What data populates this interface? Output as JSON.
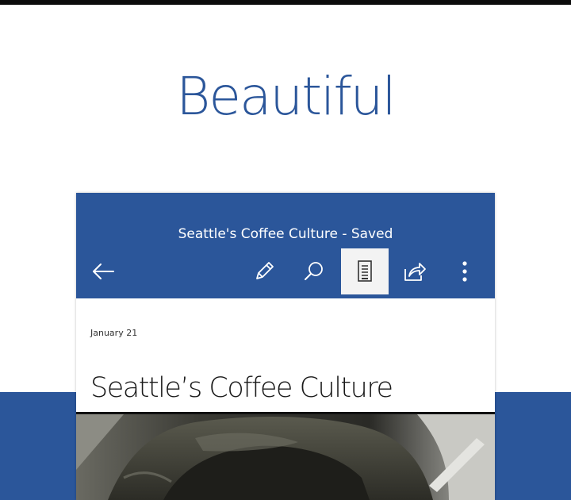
{
  "promo": {
    "headline": "Beautiful"
  },
  "app": {
    "doc_title": "Seattle's Coffee Culture - Saved",
    "toolbar": {
      "back_icon": "back-arrow-icon",
      "edit_icon": "pencil-icon",
      "search_icon": "search-icon",
      "reading_view_icon": "mobile-view-icon",
      "reading_view_active": true,
      "share_icon": "share-icon",
      "more_icon": "more-vertical-icon"
    }
  },
  "document": {
    "date": "January 21",
    "heading": "Seattle’s Coffee Culture"
  },
  "colors": {
    "brand_blue": "#2b569a",
    "active_button_bg": "#f3f3f3"
  }
}
